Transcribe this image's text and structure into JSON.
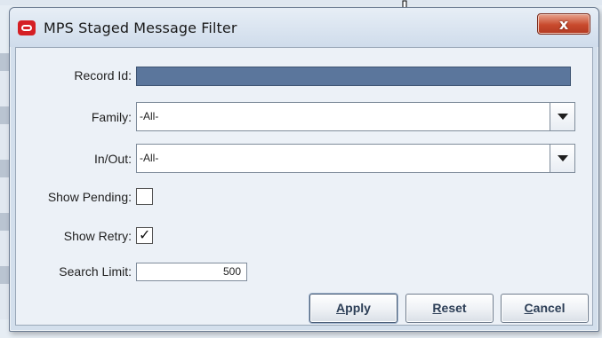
{
  "dialog": {
    "title": "MPS Staged Message Filter",
    "close_symbol": "x"
  },
  "form": {
    "record_id": {
      "label": "Record Id:",
      "value": ""
    },
    "family": {
      "label": "Family:",
      "value": "-All-"
    },
    "in_out": {
      "label": "In/Out:",
      "value": "-All-"
    },
    "show_pending": {
      "label": "Show Pending:",
      "checked": false,
      "mark": ""
    },
    "show_retry": {
      "label": "Show Retry:",
      "checked": true,
      "mark": "✓"
    },
    "search_limit": {
      "label": "Search Limit:",
      "value": "500"
    }
  },
  "buttons": {
    "apply": {
      "mnemonic": "A",
      "rest": "pply"
    },
    "reset": {
      "mnemonic": "R",
      "rest": "eset"
    },
    "cancel": {
      "mnemonic": "C",
      "rest": "ancel"
    }
  },
  "colors": {
    "app_icon": "#d51f24",
    "close_button": "#c84a2d",
    "selected_field": "#5b769c"
  },
  "icons": [
    "oracle-app-icon",
    "close-icon",
    "dropdown-arrow-icon",
    "checkmark-icon",
    "mouse-cursor-icon"
  ]
}
